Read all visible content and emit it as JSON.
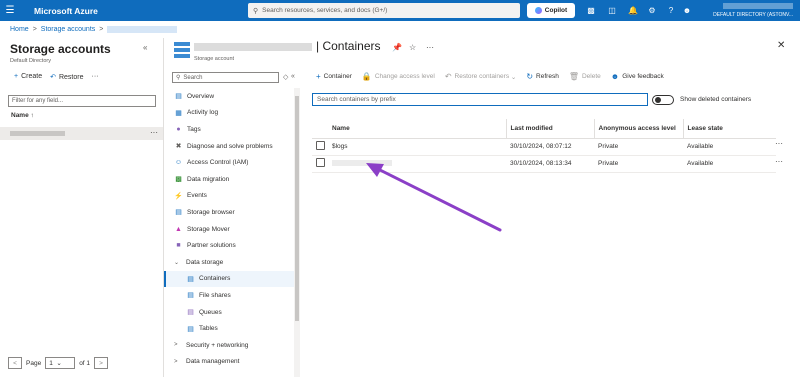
{
  "topbar": {
    "brand": "Microsoft Azure",
    "search_placeholder": "Search resources, services, and docs (G+/)",
    "copilot": "Copilot",
    "account_line": "DEFAULT DIRECTORY (ASTONV..."
  },
  "breadcrumb": {
    "home": "Home",
    "storage": "Storage accounts",
    "sep": ">"
  },
  "left_blade": {
    "title": "Storage accounts",
    "subtitle": "Default Directory",
    "create": "Create",
    "restore": "Restore",
    "more": "···",
    "filter_placeholder": "Filter for any field...",
    "col_name": "Name ↑",
    "pager_page": "Page",
    "pager_value": "1",
    "pager_of": "of 1"
  },
  "resource": {
    "title": "| Containers",
    "subtitle": "Storage account"
  },
  "menu": {
    "search_placeholder": "Search",
    "items": [
      {
        "label": "Overview",
        "icon": "overview-icon"
      },
      {
        "label": "Activity log",
        "icon": "activity-log-icon"
      },
      {
        "label": "Tags",
        "icon": "tags-icon"
      },
      {
        "label": "Diagnose and solve problems",
        "icon": "diagnose-icon"
      },
      {
        "label": "Access Control (IAM)",
        "icon": "iam-icon"
      },
      {
        "label": "Data migration",
        "icon": "data-migration-icon"
      },
      {
        "label": "Events",
        "icon": "events-icon"
      },
      {
        "label": "Storage browser",
        "icon": "storage-browser-icon"
      },
      {
        "label": "Storage Mover",
        "icon": "storage-mover-icon"
      },
      {
        "label": "Partner solutions",
        "icon": "partner-icon"
      },
      {
        "label": "Data storage",
        "icon": "chevron-down-icon"
      },
      {
        "label": "Containers",
        "icon": "containers-icon"
      },
      {
        "label": "File shares",
        "icon": "file-shares-icon"
      },
      {
        "label": "Queues",
        "icon": "queues-icon"
      },
      {
        "label": "Tables",
        "icon": "tables-icon"
      },
      {
        "label": "Security + networking",
        "icon": "chevron-right-icon"
      },
      {
        "label": "Data management",
        "icon": "chevron-right-icon"
      }
    ]
  },
  "commands": {
    "container": "Container",
    "change_access": "Change access level",
    "restore": "Restore containers",
    "refresh": "Refresh",
    "delete": "Delete",
    "feedback": "Give feedback"
  },
  "containers": {
    "search_placeholder": "Search containers by prefix",
    "show_deleted": "Show deleted containers",
    "columns": [
      "Name",
      "Last modified",
      "Anonymous access level",
      "Lease state"
    ],
    "rows": [
      {
        "name": "$logs",
        "modified": "30/10/2024, 08:07:12",
        "access": "Private",
        "lease": "Available"
      },
      {
        "name": "",
        "modified": "30/10/2024, 08:13:34",
        "access": "Private",
        "lease": "Available"
      }
    ]
  },
  "colors": {
    "accent": "#0f6cbd",
    "annotation_arrow": "#8b3fc7"
  }
}
